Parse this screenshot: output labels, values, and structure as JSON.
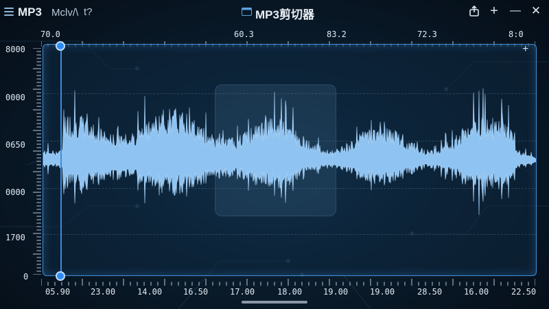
{
  "header": {
    "brand": "MP3",
    "subtitle": "Mclv/\\",
    "subtitle_extra": "t?",
    "title": "MP3剪切器",
    "buttons": {
      "share_icon": "share-icon",
      "add_label": "+",
      "minimize_label": "—",
      "close_label": "✕"
    }
  },
  "top_axis": {
    "labels": [
      "70.0",
      "60.3",
      "83.2",
      "72.3",
      "8:0"
    ]
  },
  "y_axis": {
    "labels": [
      "8000",
      "0000",
      "0650",
      "0000",
      "1700",
      "0"
    ]
  },
  "bottom_axis": {
    "labels": [
      "05.90",
      "23.00",
      "14.00",
      "16.50",
      "17.00",
      "18.00",
      "19.00",
      "19.00",
      "28.50",
      "16.00",
      "22.50"
    ]
  },
  "colors": {
    "accent": "#3d8de0",
    "waveform": "#8fc3f1",
    "background": "#07121d"
  },
  "chart_data": {
    "type": "area",
    "x_tick_labels_top": [
      "70.0",
      "60.3",
      "83.2",
      "72.3",
      "8:0"
    ],
    "x_tick_labels_bottom": [
      "05.90",
      "23.00",
      "14.00",
      "16.50",
      "17.00",
      "18.00",
      "19.00",
      "19.00",
      "28.50",
      "16.00",
      "22.50"
    ],
    "y_tick_labels": [
      "8000",
      "0000",
      "0650",
      "0000",
      "1700",
      "0"
    ],
    "grid": true,
    "selection": {
      "start_fraction": 0.04,
      "end_fraction": 0.955
    }
  }
}
